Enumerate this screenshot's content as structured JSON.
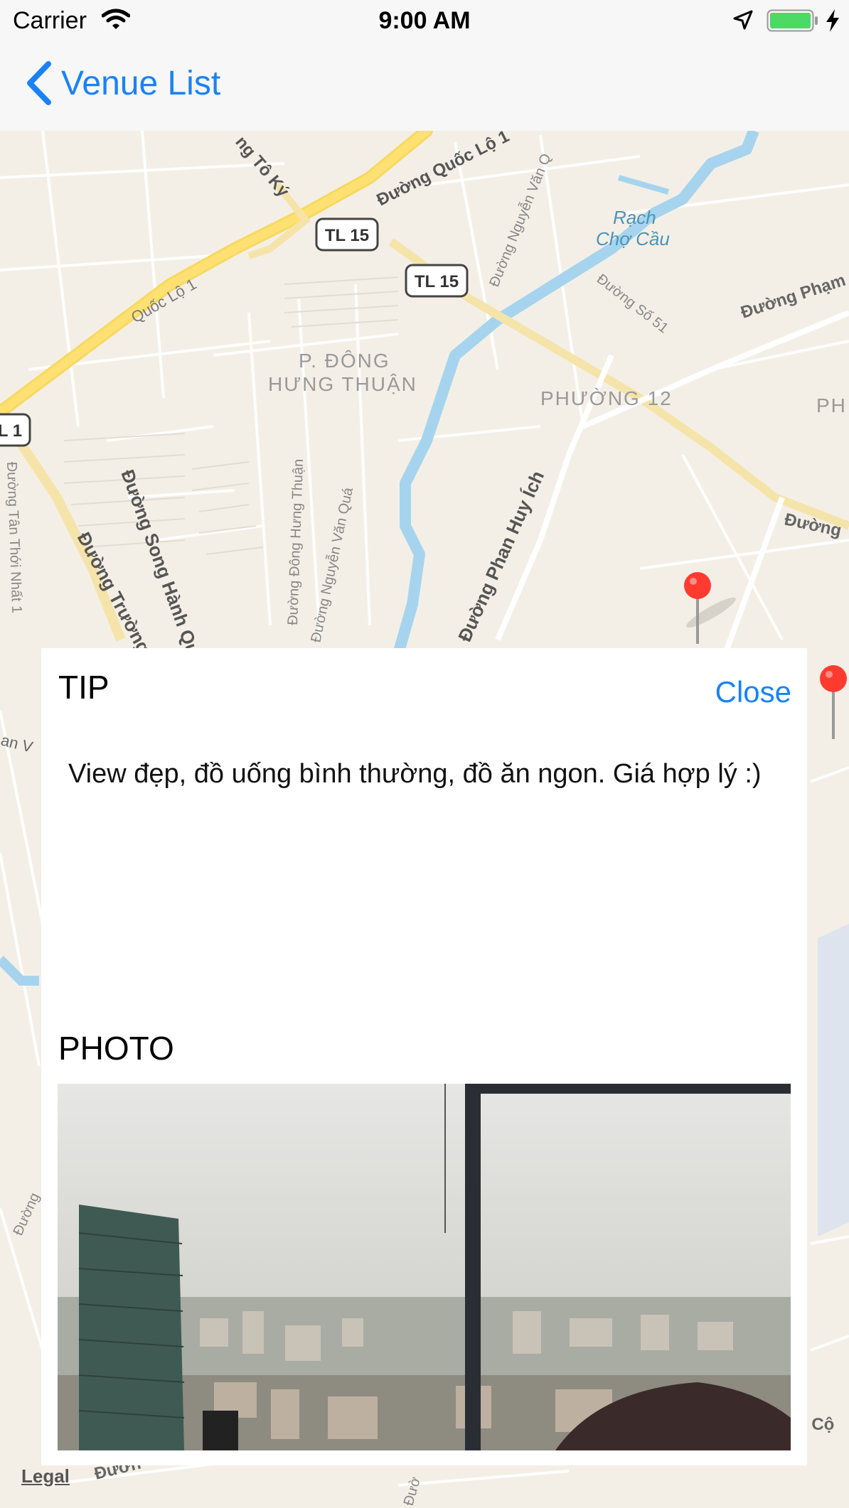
{
  "status_bar": {
    "carrier": "Carrier",
    "time": "9:00 AM",
    "battery_color": "#4cd964"
  },
  "nav": {
    "back_label": "Venue List",
    "accent_color": "#1a82f7"
  },
  "map": {
    "labels": {
      "road_to_ky": "ng Tô Ký",
      "duong_quoc_lo": "Đường Quốc Lộ 1",
      "tl15_a": "TL 15",
      "tl15_b": "TL 15",
      "quoc_lo_1": "Quốc Lộ 1",
      "nguyen_van_qua_top": "Đường Nguyễn Văn Q",
      "rach_cho_cau_1": "Rạch",
      "rach_cho_cau_2": "Chợ Cầu",
      "duong_so_51": "Đường Số 51",
      "duong_pham": "Đường Phạm",
      "ward_dong_1": "P. ĐÔNG",
      "ward_dong_2": "HƯNG THUẬN",
      "ward_12": "PHƯỜNG 12",
      "ward_ph": "PH",
      "ql1_shield": "L 1",
      "tan_thoi_nhat": "Đường Tân Thới Nhất 1",
      "song_hanh": "Đường Song Hành Qu",
      "dong_hung_thuan": "Đường Đông Hưng Thuận",
      "nguyen_van_qua": "Đường Nguyễn Văn Quá",
      "phan_huy_ich": "Đường Phan Huy Ích",
      "duong_truong": "Đường Trường",
      "duong_right": "Đường",
      "an_v": "an V",
      "duong_bottom_left": "Đường",
      "duong_bottom": "Đườn",
      "duong_bottom_mid": "Đườ",
      "g_co": "g Cộ"
    },
    "legal": "Legal",
    "pin_color": "#ff3b30"
  },
  "panel": {
    "tip_heading": "TIP",
    "close_label": "Close",
    "tip_text": "View đẹp, đồ uống bình thường, đồ ăn ngon. Giá hợp lý :)",
    "photo_heading": "PHOTO"
  }
}
